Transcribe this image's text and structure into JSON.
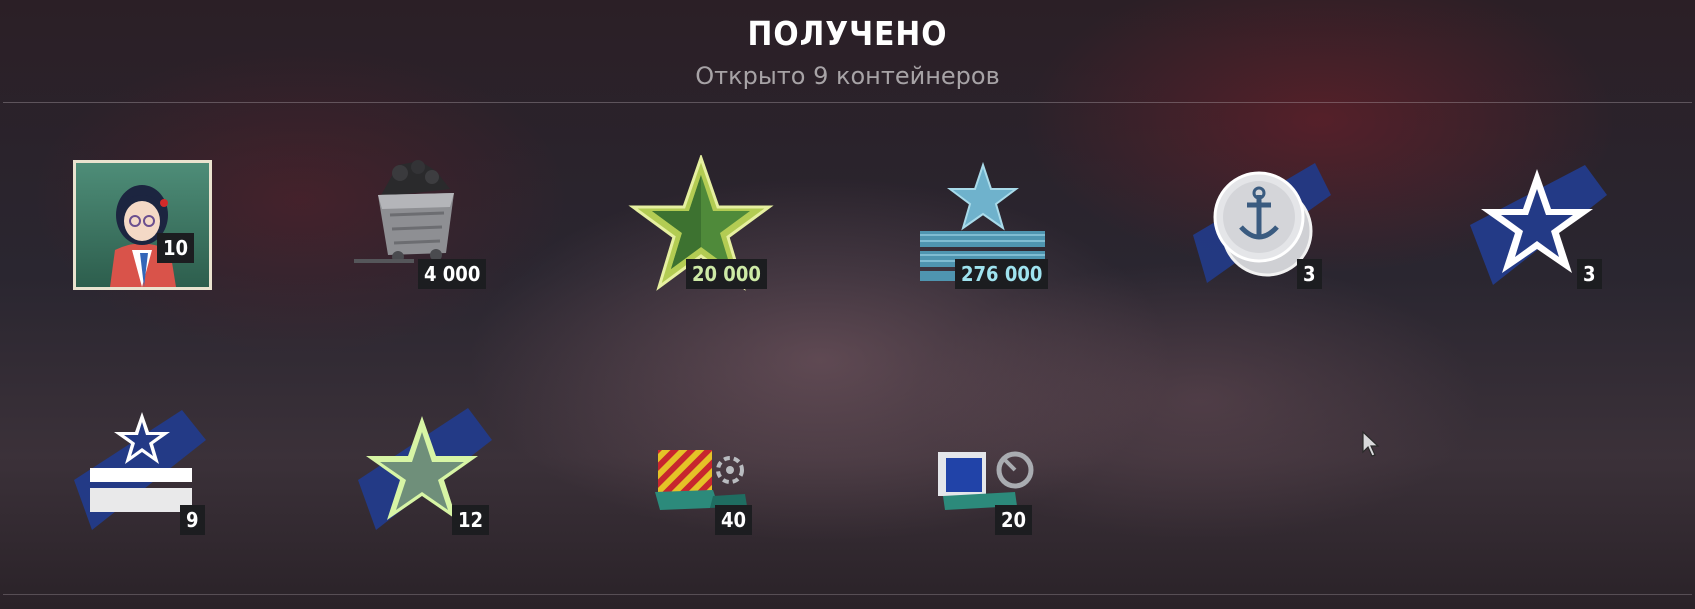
{
  "header": {
    "title": "ПОЛУЧЕНО",
    "subtitle": "Открыто 9 контейнеров"
  },
  "rewards": [
    {
      "icon": "commander-portrait-icon",
      "quantity": "10"
    },
    {
      "icon": "coal-cart-icon",
      "quantity": "4 000"
    },
    {
      "icon": "free-xp-star-icon",
      "quantity": "20 000"
    },
    {
      "icon": "elite-commander-xp-icon",
      "quantity": "276 000"
    },
    {
      "icon": "anchor-coins-icon",
      "quantity": "3"
    },
    {
      "icon": "white-star-camo-icon",
      "quantity": "3"
    },
    {
      "icon": "commander-xp-boost-icon",
      "quantity": "9"
    },
    {
      "icon": "green-star-boost-icon",
      "quantity": "12"
    },
    {
      "icon": "signal-flag-icon",
      "quantity": "40"
    },
    {
      "icon": "camouflage-consumable-icon",
      "quantity": "20"
    }
  ],
  "colors": {
    "camo_blue": "#233a86",
    "free_xp_green": "#a8c64a",
    "elite_xp_cyan": "#7ec4d8"
  }
}
